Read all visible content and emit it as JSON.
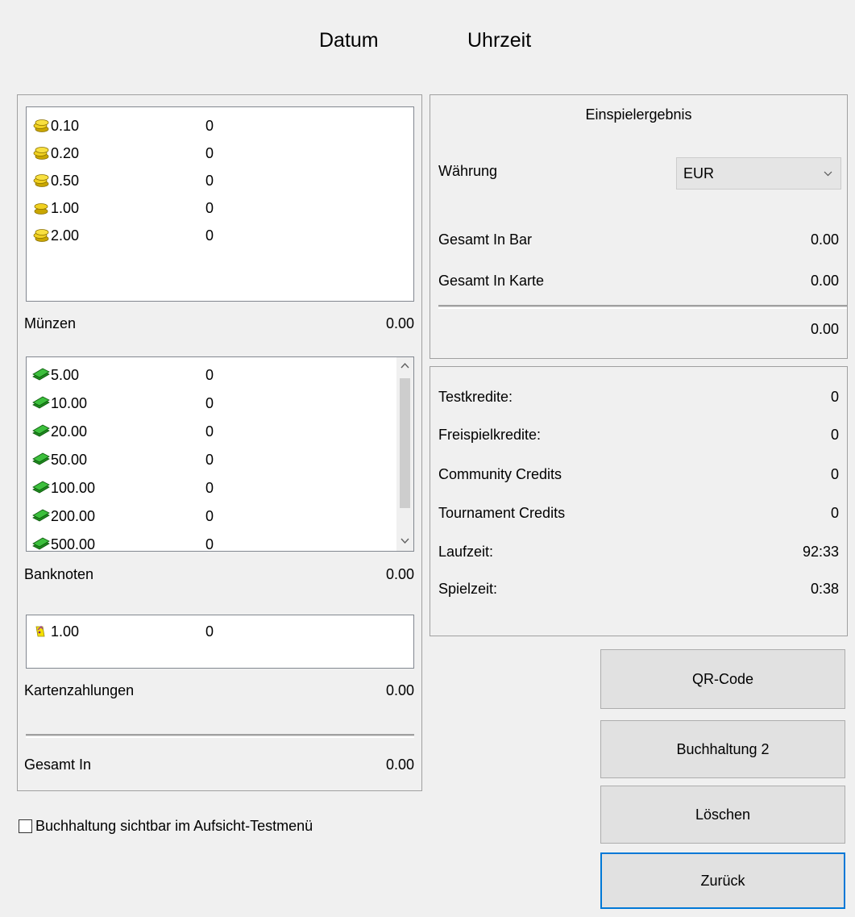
{
  "header": {
    "date_label": "Datum",
    "time_label": "Uhrzeit"
  },
  "coins": {
    "items": [
      {
        "denom": "0.10",
        "count": "0"
      },
      {
        "denom": "0.20",
        "count": "0"
      },
      {
        "denom": "0.50",
        "count": "0"
      },
      {
        "denom": "1.00",
        "count": "0"
      },
      {
        "denom": "2.00",
        "count": "0"
      }
    ],
    "label": "Münzen",
    "total": "0.00"
  },
  "notes": {
    "items": [
      {
        "denom": "5.00",
        "count": "0"
      },
      {
        "denom": "10.00",
        "count": "0"
      },
      {
        "denom": "20.00",
        "count": "0"
      },
      {
        "denom": "50.00",
        "count": "0"
      },
      {
        "denom": "100.00",
        "count": "0"
      },
      {
        "denom": "200.00",
        "count": "0"
      },
      {
        "denom": "500.00",
        "count": "0"
      }
    ],
    "label": "Banknoten",
    "total": "0.00"
  },
  "cards": {
    "items": [
      {
        "denom": "1.00",
        "count": "0"
      }
    ],
    "label": "Kartenzahlungen",
    "total": "0.00"
  },
  "grand_total": {
    "label": "Gesamt In",
    "value": "0.00"
  },
  "checkbox": {
    "label": "Buchhaltung sichtbar im Aufsicht-Testmenü",
    "checked": false
  },
  "result": {
    "title": "Einspielergebnis",
    "currency_label": "Währung",
    "currency_value": "EUR",
    "cash_label": "Gesamt In Bar",
    "cash_value": "0.00",
    "card_label": "Gesamt In Karte",
    "card_value": "0.00",
    "total_value": "0.00"
  },
  "stats": [
    {
      "label": "Testkredite:",
      "value": "0"
    },
    {
      "label": "Freispielkredite:",
      "value": "0"
    },
    {
      "label": "Community Credits",
      "value": "0"
    },
    {
      "label": "Tournament Credits",
      "value": "0"
    },
    {
      "label": "Laufzeit:",
      "value": "92:33"
    },
    {
      "label": "Spielzeit:",
      "value": "0:38"
    }
  ],
  "buttons": {
    "qr": "QR-Code",
    "accounting2": "Buchhaltung 2",
    "delete": "Löschen",
    "back": "Zurück"
  },
  "colors": {
    "focus_border": "#0078d7",
    "coin_gold": "#e8c81a",
    "note_green": "#2e9a2e"
  }
}
